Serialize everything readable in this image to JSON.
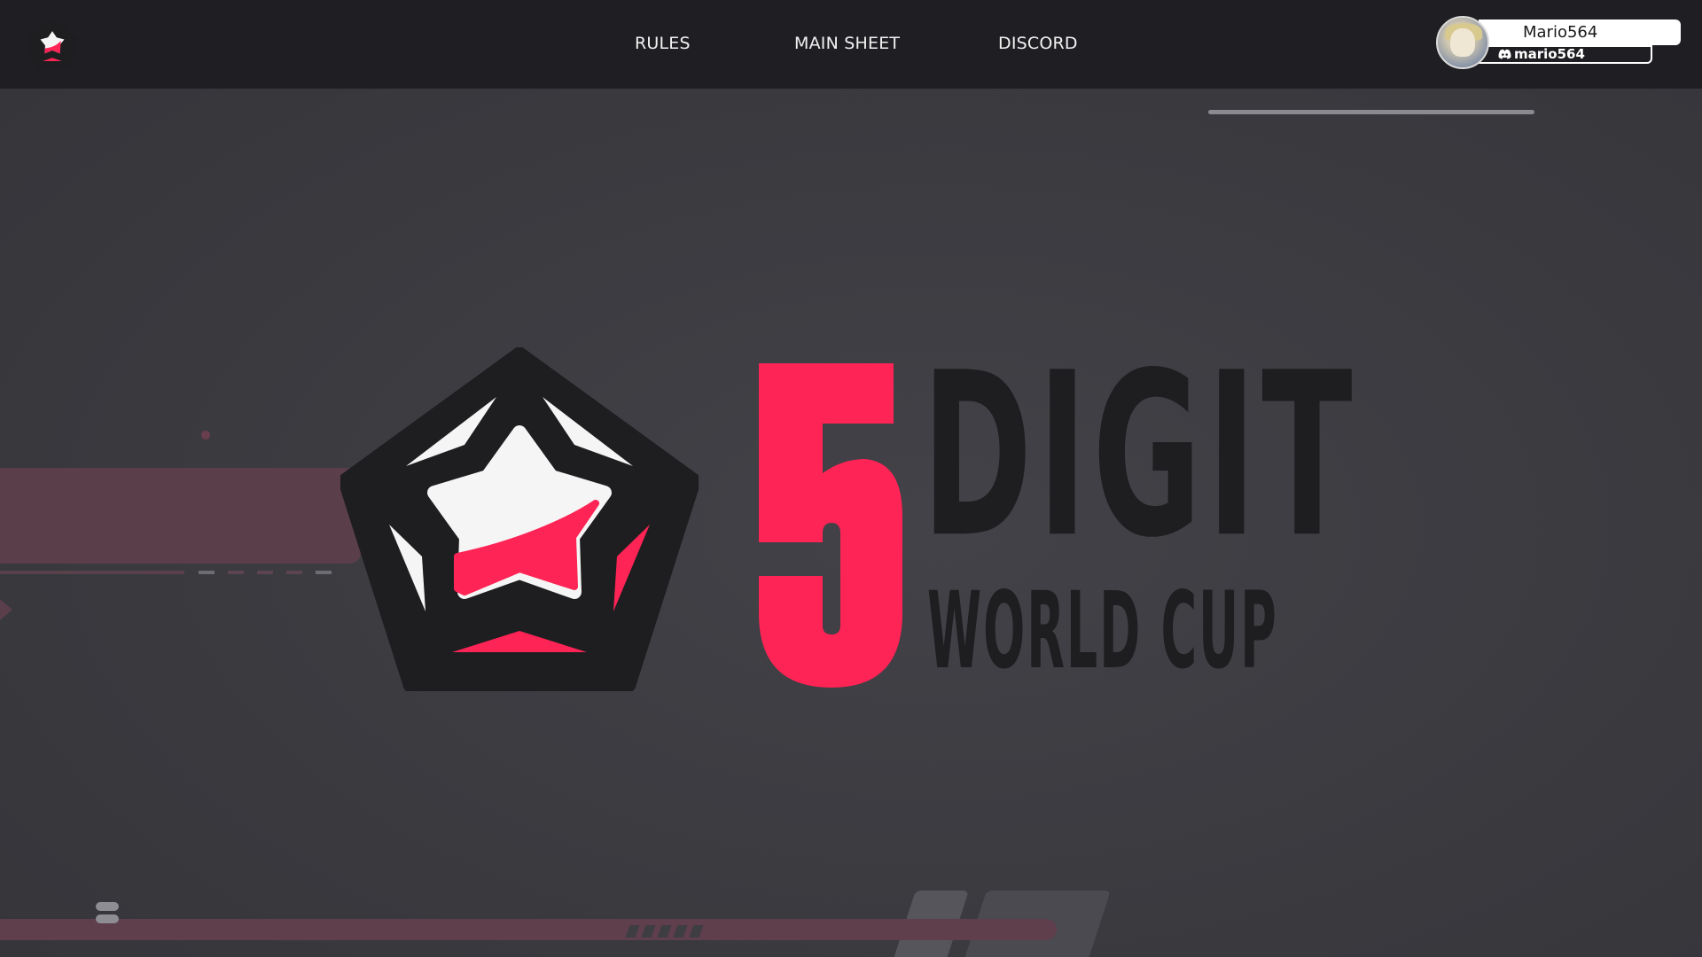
{
  "nav": {
    "links": [
      "RULES",
      "MAIN SHEET",
      "DISCORD"
    ]
  },
  "user": {
    "username": "Mario564",
    "discord": "mario564"
  },
  "hero": {
    "number": "5",
    "line1": "DIGIT",
    "line2": "WORLD CUP"
  },
  "colors": {
    "accent": "#fe2455",
    "nav_bg": "#1f1f23",
    "page_bg": "#3b3b40",
    "logo_dark": "#1e1e21",
    "logo_light": "#f5f5f5"
  },
  "icons": [
    "tournament-logo-icon",
    "discord-icon"
  ]
}
